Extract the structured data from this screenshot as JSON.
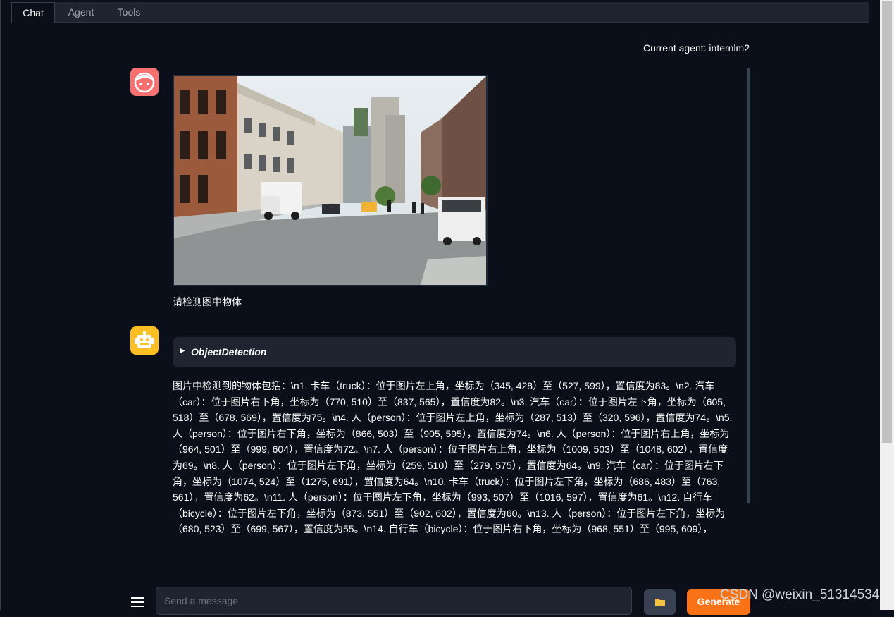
{
  "tabs": [
    {
      "label": "Chat",
      "active": true
    },
    {
      "label": "Agent",
      "active": false
    },
    {
      "label": "Tools",
      "active": false
    }
  ],
  "status": {
    "current_agent": "Current agent: internlm2"
  },
  "messages": {
    "user": {
      "avatar": "user-face-icon",
      "image": "street-scene-photo",
      "text": "请检测图中物体"
    },
    "bot": {
      "avatar": "robot-icon",
      "tool_name": "ObjectDetection",
      "text": "图片中检测到的物体包括：\\n1. 卡车（truck）：位于图片左上角，坐标为（345, 428）至（527, 599），置信度为83。\\n2. 汽车（car）：位于图片右下角，坐标为（770, 510）至（837, 565），置信度为82。\\n3. 汽车（car）：位于图片左下角，坐标为（605, 518）至（678, 569），置信度为75。\\n4. 人（person）：位于图片左上角，坐标为（287, 513）至（320, 596），置信度为74。\\n5. 人（person）：位于图片右下角，坐标为（866, 503）至（905, 595），置信度为74。\\n6. 人（person）：位于图片右上角，坐标为（964, 501）至（999, 604），置信度为72。\\n7. 人（person）：位于图片右上角，坐标为（1009, 503）至（1048, 602），置信度为69。\\n8. 人（person）：位于图片左下角，坐标为（259, 510）至（279, 575），置信度为64。\\n9. 汽车（car）：位于图片右下角，坐标为（1074, 524）至（1275, 691），置信度为64。\\n10. 卡车（truck）：位于图片左下角，坐标为（686, 483）至（763, 561），置信度为62。\\n11. 人（person）：位于图片左下角，坐标为（993, 507）至（1016, 597），置信度为61。\\n12. 自行车（bicycle）：位于图片左下角，坐标为（873, 551）至（902, 602），置信度为60。\\n13. 人（person）：位于图片左下角，坐标为（680, 523）至（699, 567），置信度为55。\\n14. 自行车（bicycle）：位于图片右下角，坐标为（968, 551）至（995, 609），"
    }
  },
  "composer": {
    "placeholder": "Send a message",
    "menu_icon": "hamburger-menu-icon",
    "upload_icon": "folder-icon",
    "generate_label": "Generate"
  },
  "watermark": "CSDN @weixin_51314534",
  "colors": {
    "background": "#0b0f19",
    "panel": "#1f2430",
    "accent": "#f97316",
    "user_avatar": "#f87171",
    "bot_avatar": "#fbbf24"
  }
}
